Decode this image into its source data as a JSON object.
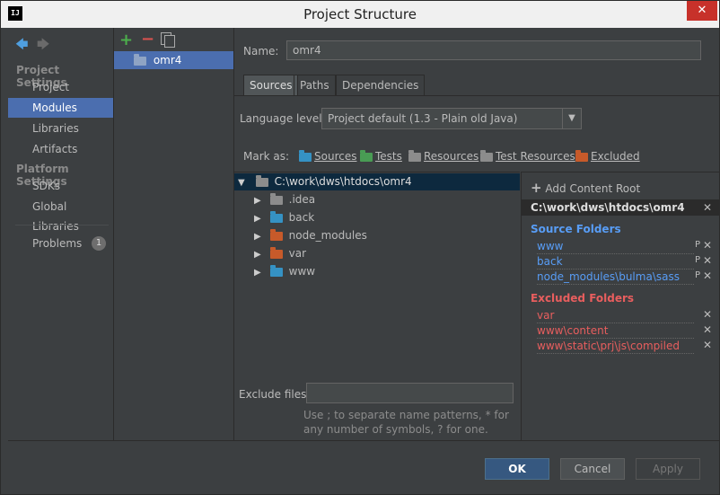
{
  "window": {
    "title": "Project Structure",
    "app_icon": "IJ",
    "close_glyph": "✕"
  },
  "nav": {
    "back_glyph": "🡄",
    "forward_glyph": "🡆",
    "project_settings_header": "Project Settings",
    "project_items": [
      "Project",
      "Modules",
      "Libraries",
      "Artifacts"
    ],
    "platform_settings_header": "Platform Settings",
    "platform_items": [
      "SDKs",
      "Global Libraries"
    ],
    "problems_label": "Problems",
    "problems_count": "1",
    "selected": "Modules"
  },
  "modules": {
    "add_glyph": "+",
    "remove_glyph": "−",
    "items": [
      "omr4"
    ]
  },
  "details": {
    "name_label": "Name:",
    "name_value": "omr4",
    "tabs": [
      "Sources",
      "Paths",
      "Dependencies"
    ],
    "active_tab": "Sources",
    "language_level_label": "Language level:",
    "language_level_value": "Project default (1.3 - Plain old Java)",
    "mark_as_label": "Mark as:",
    "marks": [
      {
        "label": "Sources",
        "color": "#3592c4"
      },
      {
        "label": "Tests",
        "color": "#499c54"
      },
      {
        "label": "Resources",
        "color": "#8c8c8c"
      },
      {
        "label": "Test Resources",
        "color": "#8c8c8c"
      },
      {
        "label": "Excluded",
        "color": "#c75a2a"
      }
    ],
    "tree_root": "C:\\work\\dws\\htdocs\\omr4",
    "tree_children": [
      {
        "label": ".idea",
        "color": "#8c8c8c"
      },
      {
        "label": "back",
        "color": "#3592c4"
      },
      {
        "label": "node_modules",
        "color": "#c75a2a"
      },
      {
        "label": "var",
        "color": "#c75a2a"
      },
      {
        "label": "www",
        "color": "#3592c4"
      }
    ],
    "exclude_files_label": "Exclude files:",
    "exclude_hint": "Use ; to separate name patterns, * for any number of symbols, ? for one."
  },
  "content_root": {
    "add_label": "Add Content Root",
    "root_path": "C:\\work\\dws\\htdocs\\omr4",
    "source_header": "Source Folders",
    "source_folders": [
      "www",
      "back",
      "node_modules\\bulma\\sass"
    ],
    "excluded_header": "Excluded Folders",
    "excluded_folders": [
      "var",
      "www\\content",
      "www\\static\\prj\\js\\compiled"
    ]
  },
  "buttons": {
    "ok": "OK",
    "cancel": "Cancel",
    "apply": "Apply"
  },
  "colors": {
    "accent": "#4b6eaf",
    "source": "#589df6",
    "excluded": "#e85e5e"
  }
}
